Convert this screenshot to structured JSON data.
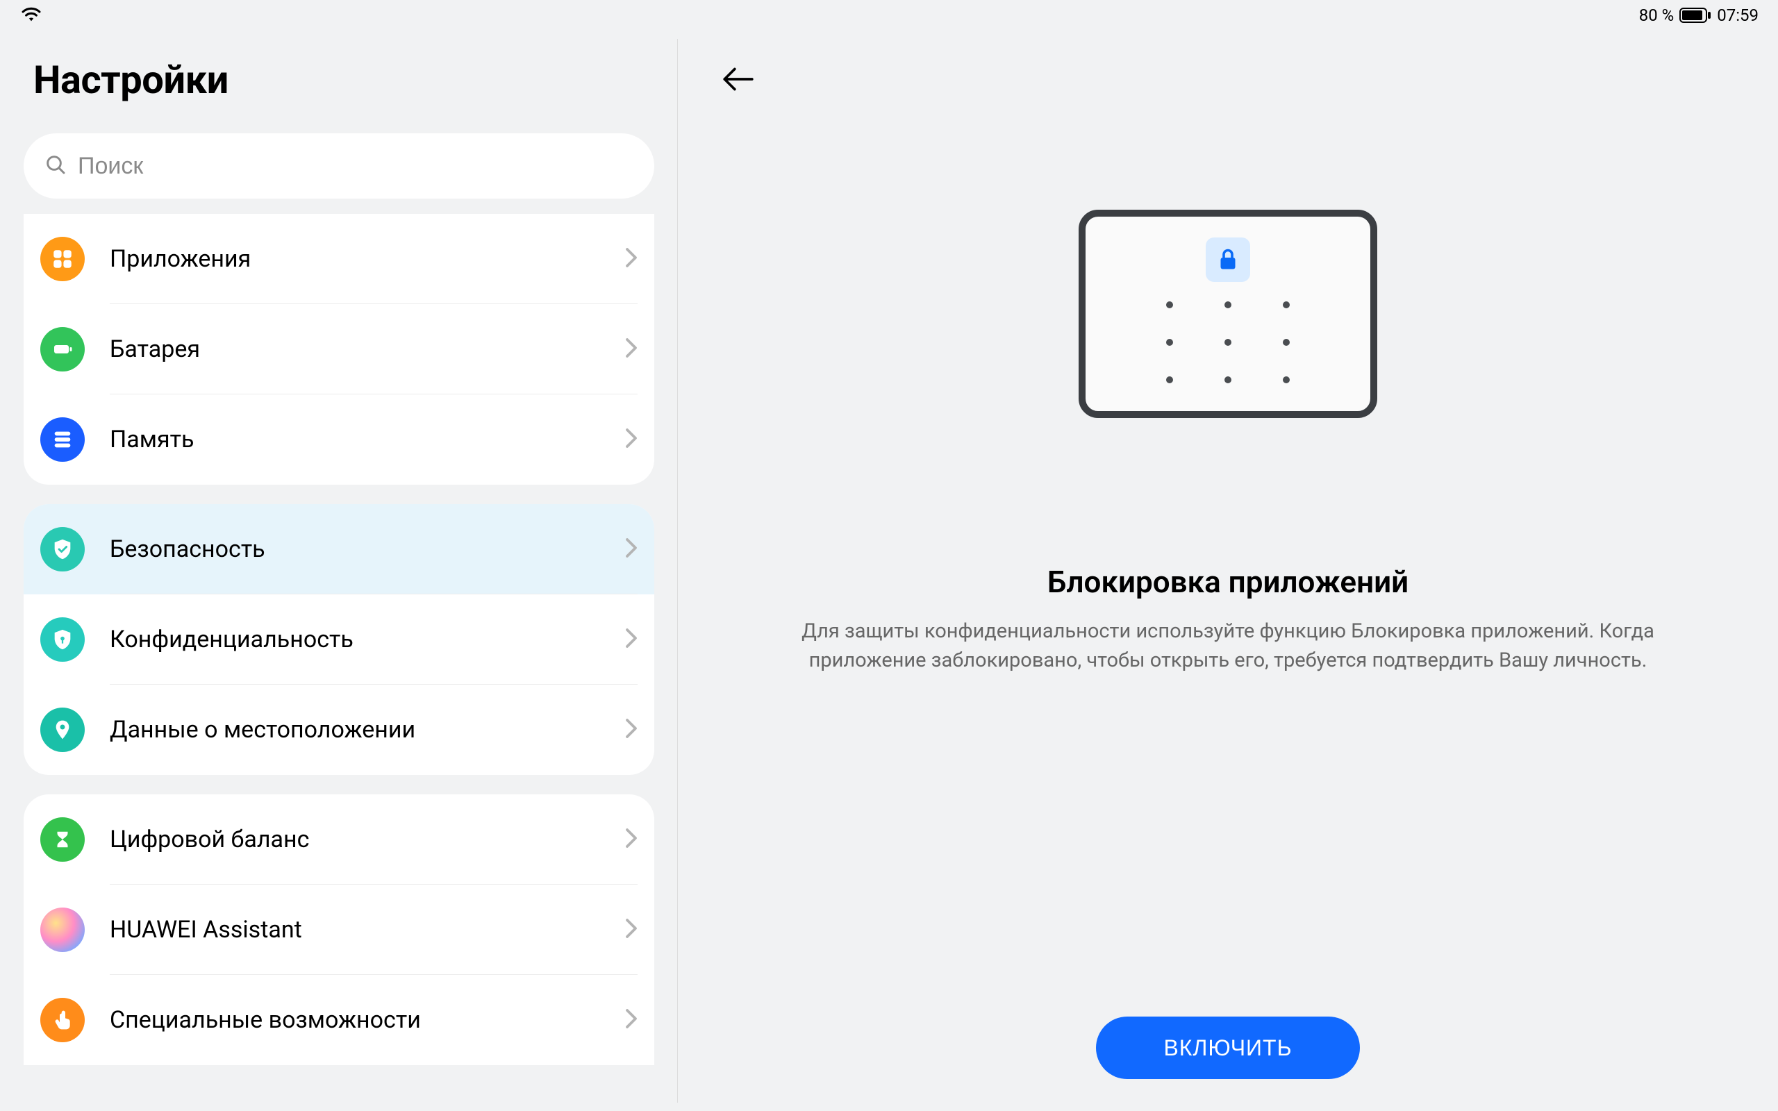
{
  "statusbar": {
    "battery_text": "80 %",
    "time": "07:59"
  },
  "sidebar": {
    "title": "Настройки",
    "search_placeholder": "Поиск",
    "groups": [
      {
        "items": [
          {
            "id": "apps",
            "label": "Приложения",
            "icon": "apps-icon",
            "color": "#ff9a16",
            "selected": false
          },
          {
            "id": "battery",
            "label": "Батарея",
            "icon": "battery-icon",
            "color": "#32c45a",
            "selected": false
          },
          {
            "id": "storage",
            "label": "Память",
            "icon": "storage-icon",
            "color": "#1a5dff",
            "selected": false
          }
        ]
      },
      {
        "items": [
          {
            "id": "security",
            "label": "Безопасность",
            "icon": "shield-check-icon",
            "color": "#29c9b2",
            "selected": true
          },
          {
            "id": "privacy",
            "label": "Конфиденциальность",
            "icon": "privacy-icon",
            "color": "#26cbbd",
            "selected": false
          },
          {
            "id": "location",
            "label": "Данные о местоположении",
            "icon": "location-icon",
            "color": "#1ac0a8",
            "selected": false
          }
        ]
      },
      {
        "items": [
          {
            "id": "digital",
            "label": "Цифровой баланс",
            "icon": "hourglass-icon",
            "color": "#34c24d",
            "selected": false
          },
          {
            "id": "assistant",
            "label": "HUAWEI Assistant",
            "icon": "assistant-icon",
            "color": "gradient",
            "selected": false
          },
          {
            "id": "access",
            "label": "Специальные возможности",
            "icon": "touch-icon",
            "color": "#ff8c1a",
            "selected": false
          }
        ]
      }
    ]
  },
  "main": {
    "title": "Блокировка приложений",
    "description": "Для защиты конфиденциальности используйте функцию Блокировка приложений. Когда приложение заблокировано, чтобы открыть его, требуется подтвердить Вашу личность.",
    "primary_button": "ВКЛЮЧИТЬ"
  }
}
